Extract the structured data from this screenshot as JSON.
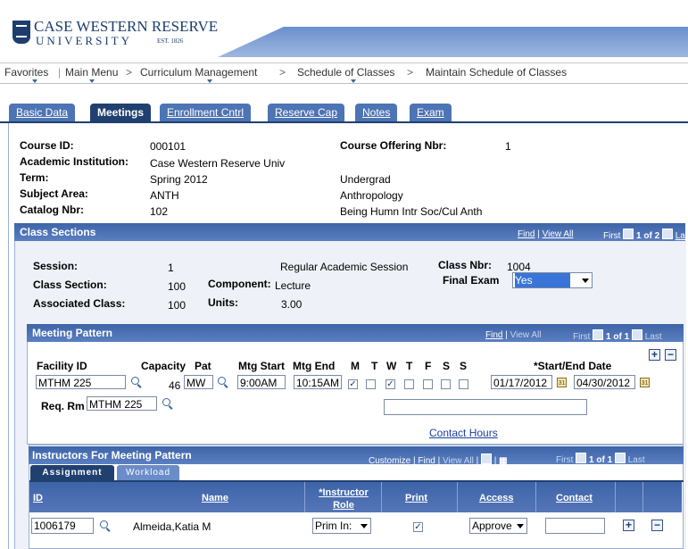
{
  "header": {
    "logo_line1": "CASE WESTERN RESERVE",
    "logo_line2": "UNIVERSITY",
    "logo_est": "EST. 1826"
  },
  "nav": {
    "favorites": "Favorites",
    "main_menu": "Main Menu",
    "curriculum": "Curriculum Management",
    "schedule": "Schedule of Classes",
    "maintain": "Maintain Schedule of Classes",
    "sep": ">"
  },
  "tabs": [
    "Basic Data",
    "Meetings",
    "Enrollment Cntrl",
    "Reserve Cap",
    "Notes",
    "Exam"
  ],
  "course": {
    "course_id_label": "Course ID:",
    "course_id": "000101",
    "institution_label": "Academic Institution:",
    "institution": "Case Western Reserve Univ",
    "term_label": "Term:",
    "term": "Spring 2012",
    "term_career": "Undergrad",
    "subject_label": "Subject Area:",
    "subject": "ANTH",
    "subject_desc": "Anthropology",
    "catalog_label": "Catalog Nbr:",
    "catalog": "102",
    "catalog_desc": "Being Humn Intr Soc/Cul Anth",
    "offering_label": "Course Offering Nbr:",
    "offering": "1"
  },
  "class_sections": {
    "title": "Class Sections",
    "find": "Find",
    "view_all": "View All",
    "first": "First",
    "count": "1 of 2",
    "last": "Last",
    "session_label": "Session:",
    "session": "1",
    "session_desc": "Regular Academic Session",
    "class_nbr_label": "Class Nbr:",
    "class_nbr": "1004",
    "class_section_label": "Class Section:",
    "class_section": "100",
    "component_label": "Component:",
    "component": "Lecture",
    "final_exam_label": "Final Exam",
    "final_exam": "Yes",
    "assoc_label": "Associated Class:",
    "assoc": "100",
    "units_label": "Units:",
    "units": "3.00"
  },
  "meeting_pattern": {
    "title": "Meeting Pattern",
    "find": "Find",
    "view_all": "View All",
    "first": "First",
    "count": "1 of 1",
    "last": "Last",
    "facility_label": "Facility ID",
    "facility": "MTHM 225",
    "capacity_label": "Capacity",
    "capacity": "46",
    "pat_label": "Pat",
    "pat": "MW",
    "start_label": "Mtg Start",
    "start": "9:00AM",
    "end_label": "Mtg End",
    "end": "10:15AM",
    "days": [
      "M",
      "T",
      "W",
      "T",
      "F",
      "S",
      "S"
    ],
    "days_checked": [
      true,
      false,
      true,
      false,
      false,
      false,
      false
    ],
    "dates_label": "*Start/End Date",
    "start_date": "01/17/2012",
    "end_date": "04/30/2012",
    "req_rm_label": "Req. Rm",
    "req_rm": "MTHM 225",
    "contact_hours": "Contact Hours"
  },
  "instructors": {
    "title": "Instructors For Meeting Pattern",
    "customize": "Customize",
    "find": "Find",
    "view_all": "View All",
    "first": "First",
    "count": "1 of 1",
    "last": "Last",
    "subtab_assignment": "Assignment",
    "subtab_workload": "Workload",
    "col_id": "ID",
    "col_name": "Name",
    "col_role": "*Instructor Role",
    "col_print": "Print",
    "col_access": "Access",
    "col_contact": "Contact",
    "row": {
      "id": "1006179",
      "name": "Almeida,Katia M",
      "role": "Prim In:",
      "print": true,
      "access": "Approve",
      "contact": ""
    }
  },
  "colors": {
    "tab": "#4d74b4",
    "tab_active": "#204070",
    "bar": "#3d64a8",
    "brand": "#1c3d6e"
  }
}
